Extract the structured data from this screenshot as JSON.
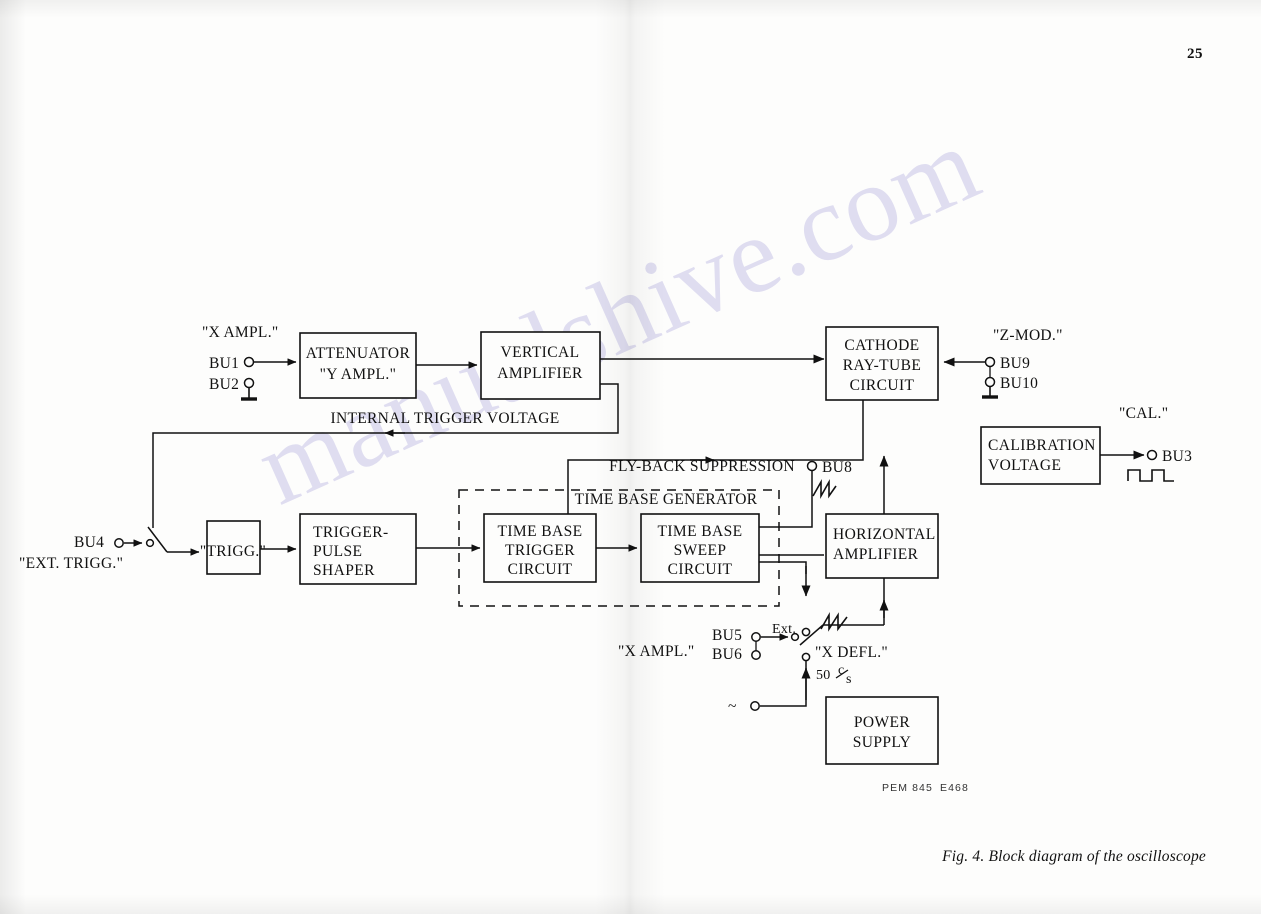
{
  "page": {
    "number": "25",
    "caption": "Fig. 4.  Block diagram of the oscilloscope",
    "drawing_code_left": "PEM 845",
    "drawing_code_right": "E468",
    "watermark": "manualshive.com"
  },
  "blocks": {
    "attenuator": {
      "line1": "ATTENUATOR",
      "line2": "\"Y AMPL.\"",
      "line3": ""
    },
    "vertical_amp": {
      "line1": "VERTICAL",
      "line2": "AMPLIFIER",
      "line3": ""
    },
    "crt": {
      "line1": "CATHODE",
      "line2": "RAY-TUBE",
      "line3": "CIRCUIT"
    },
    "calibration": {
      "line1": "CALIBRATION",
      "line2": "VOLTAGE",
      "line3": ""
    },
    "trigger_shaper": {
      "line1": "TRIGGER-",
      "line2": "PULSE",
      "line3": "SHAPER"
    },
    "tb_trigger": {
      "line1": "TIME BASE",
      "line2": "TRIGGER",
      "line3": "CIRCUIT"
    },
    "tb_sweep": {
      "line1": "TIME BASE",
      "line2": "SWEEP",
      "line3": "CIRCUIT"
    },
    "horizontal_amp": {
      "line1": "HORIZONTAL",
      "line2": "AMPLIFIER",
      "line3": ""
    },
    "power_supply": {
      "line1": "POWER",
      "line2": "SUPPLY",
      "line3": ""
    },
    "trigg_box": {
      "label": "\"TRIGG.\""
    }
  },
  "group_labels": {
    "time_base_generator": "TIME  BASE  GENERATOR",
    "internal_trigger": "INTERNAL TRIGGER VOLTAGE",
    "flyback": "FLY-BACK SUPPRESSION"
  },
  "terminals": {
    "bu1": "BU1",
    "bu2": "BU2",
    "bu3": "BU3",
    "bu4": "BU4",
    "bu5": "BU5",
    "bu6": "BU6",
    "bu8": "BU8",
    "bu9": "BU9",
    "bu10": "BU10"
  },
  "annotations": {
    "x_ampl_top": "\"X AMPL.\"",
    "x_ampl_bottom": "\"X AMPL.\"",
    "z_mod": "\"Z-MOD.\"",
    "cal": "\"CAL.\"",
    "ext_trigg": "\"EXT. TRIGG.\"",
    "ext": "Ext.",
    "x_defl": "\"X DEFL.\"",
    "mains_freq_value": "50",
    "mains_freq_num": "c",
    "mains_freq_den": "s",
    "mains_symbol": "~"
  },
  "icons": {
    "square_wave": "square-wave-icon",
    "sawtooth_bu8": "sawtooth-wave-icon",
    "sawtooth_switch": "sawtooth-wave-icon",
    "ground": "ground-icon"
  },
  "colors": {
    "ink": "#111111",
    "paper": "#fdfdfc",
    "watermark": "#9b96d6"
  }
}
